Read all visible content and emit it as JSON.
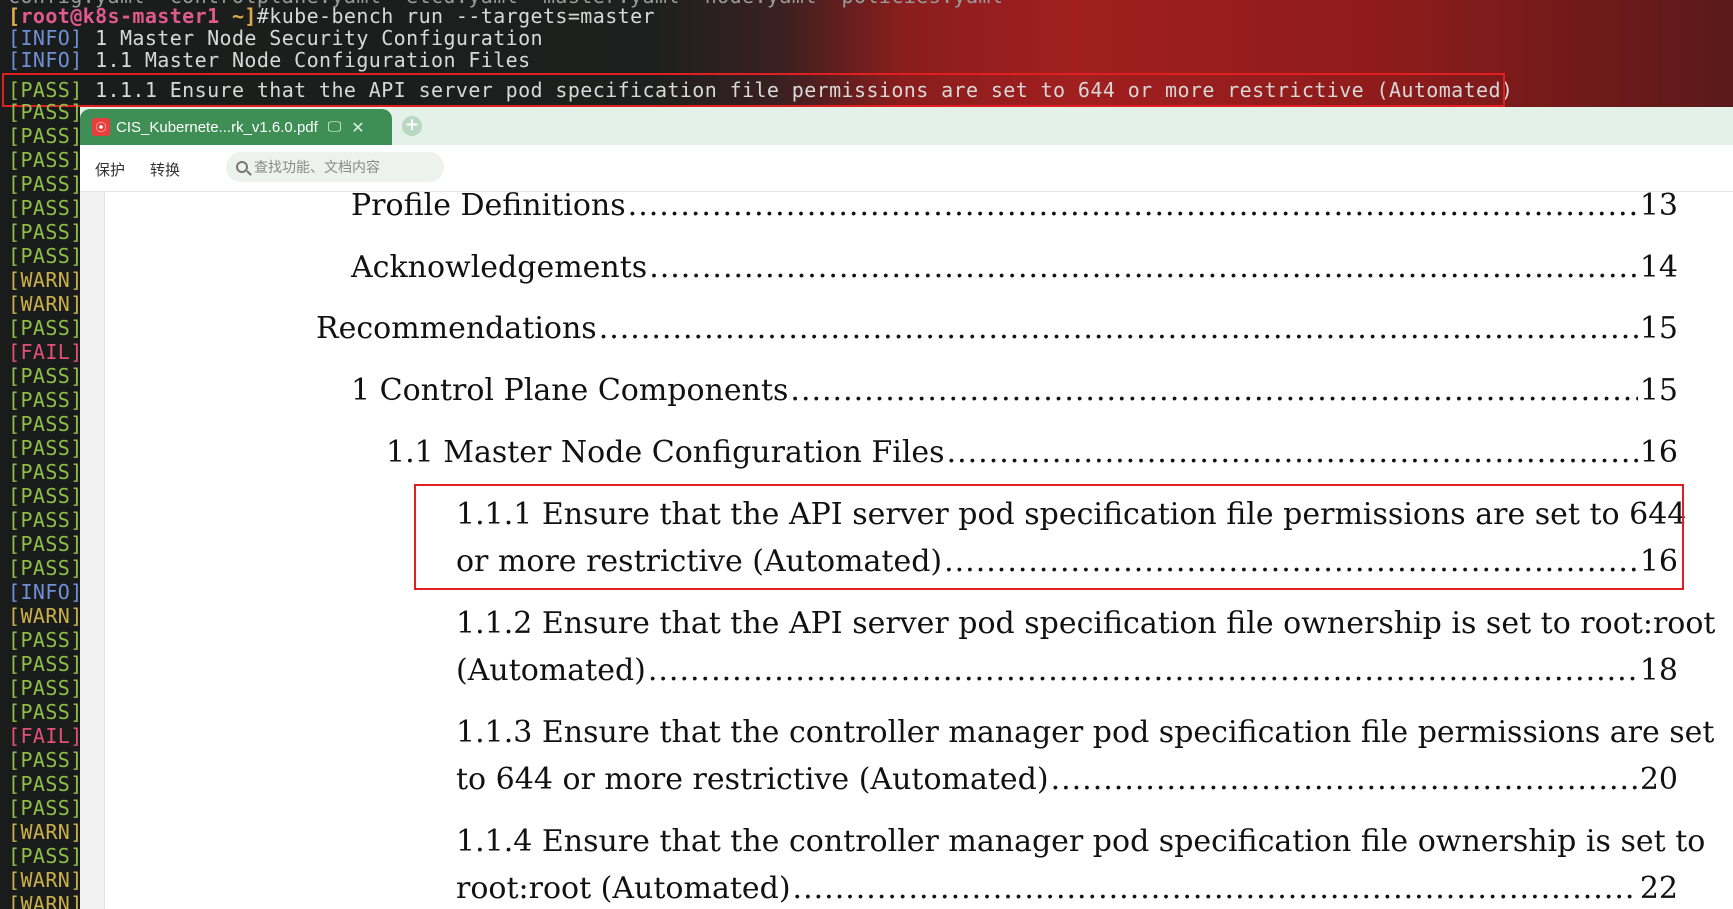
{
  "terminal": {
    "cutoff_line": "config.yaml  controlplane.yaml  etcd.yaml  master.yaml  node.yaml  policies.yaml",
    "prompt_open": "[",
    "prompt_user": "root@k8s-master1",
    "prompt_path": " ~]",
    "command": "#kube-bench run --targets=master",
    "lines": [
      {
        "tag": "[INFO]",
        "text": " 1 Master Node Security Configuration"
      },
      {
        "tag": "[INFO]",
        "text": " 1.1 Master Node Configuration Files"
      },
      {
        "tag": "[PASS]",
        "text": " 1.1.1 Ensure that the API server pod specification file permissions are set to 644 or more restrictive (Automated)"
      }
    ],
    "status_tags": [
      "[PASS]",
      "[PASS]",
      "[PASS]",
      "[PASS]",
      "[PASS]",
      "[PASS]",
      "[PASS]",
      "[WARN]",
      "[WARN]",
      "[PASS]",
      "[FAIL]",
      "[PASS]",
      "[PASS]",
      "[PASS]",
      "[PASS]",
      "[PASS]",
      "[PASS]",
      "[PASS]",
      "[PASS]",
      "[PASS]",
      "[INFO]",
      "[WARN]",
      "[PASS]",
      "[PASS]",
      "[PASS]",
      "[PASS]",
      "[FAIL]",
      "[PASS]",
      "[PASS]",
      "[PASS]",
      "[WARN]",
      "[PASS]",
      "[WARN]",
      "[WARN]"
    ]
  },
  "viewer": {
    "tab_title": "CIS_Kubernete...rk_v1.6.0.pdf",
    "toolbar": {
      "protect_label": "保护",
      "convert_label": "转换",
      "search_placeholder": "查找功能、文档内容"
    },
    "toc": [
      {
        "label": "Profile Definitions",
        "page": "13"
      },
      {
        "label": "Acknowledgements",
        "page": "14"
      },
      {
        "label": "Recommendations",
        "page": "15"
      },
      {
        "label": "1 Control Plane Components",
        "page": "15"
      },
      {
        "label": "1.1 Master Node Configuration Files",
        "page": "16"
      },
      {
        "line1": "1.1.1 Ensure that the API server pod specification file permissions are set to 644",
        "label": "or more restrictive (Automated)",
        "page": "16"
      },
      {
        "line1": "1.1.2 Ensure that the API server pod specification file ownership is set to root:root",
        "label": "(Automated)",
        "page": "18"
      },
      {
        "line1": "1.1.3 Ensure that the controller manager pod specification file permissions are set",
        "label": "to 644 or more restrictive (Automated)",
        "page": "20"
      },
      {
        "line1": "1.1.4 Ensure that the controller manager pod specification file ownership is set to",
        "label": "root:root (Automated)",
        "page": "22"
      }
    ]
  },
  "colors": {
    "highlight": "#e02020",
    "tab_green": "#3e8e55"
  }
}
